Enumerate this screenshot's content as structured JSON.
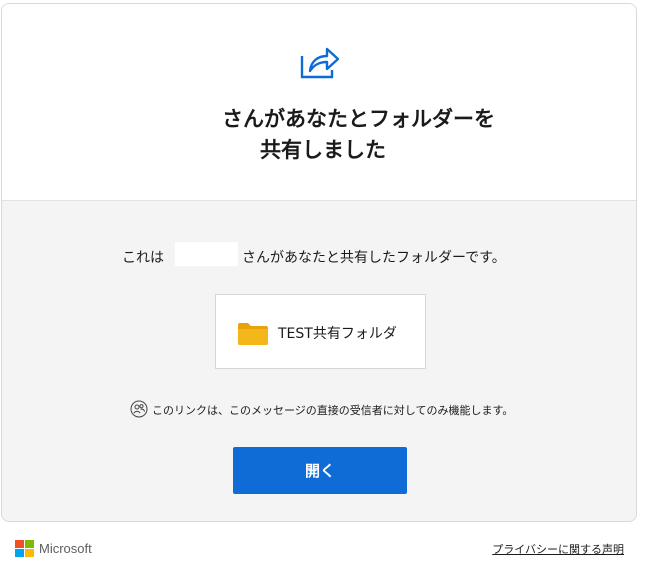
{
  "header": {
    "headline_line1": "さんがあなたとフォルダーを",
    "headline_line2": "共有しました"
  },
  "body": {
    "text_prefix": "これは",
    "text_suffix": "さんがあなたと共有したフォルダーです。"
  },
  "folder": {
    "name": "TEST共有フォルダ",
    "icon": "folder-icon"
  },
  "notice": {
    "text": "このリンクは、このメッセージの直接の受信者に対してのみ機能します。",
    "icon": "people-icon"
  },
  "actions": {
    "open_label": "開く"
  },
  "footer": {
    "brand": "Microsoft",
    "privacy_label": "プライバシーに関する声明"
  },
  "colors": {
    "accent": "#0f6cd6",
    "folder": "#f3b71b",
    "ms_red": "#f25022",
    "ms_green": "#7fba00",
    "ms_blue": "#00a4ef",
    "ms_yellow": "#ffb900"
  }
}
